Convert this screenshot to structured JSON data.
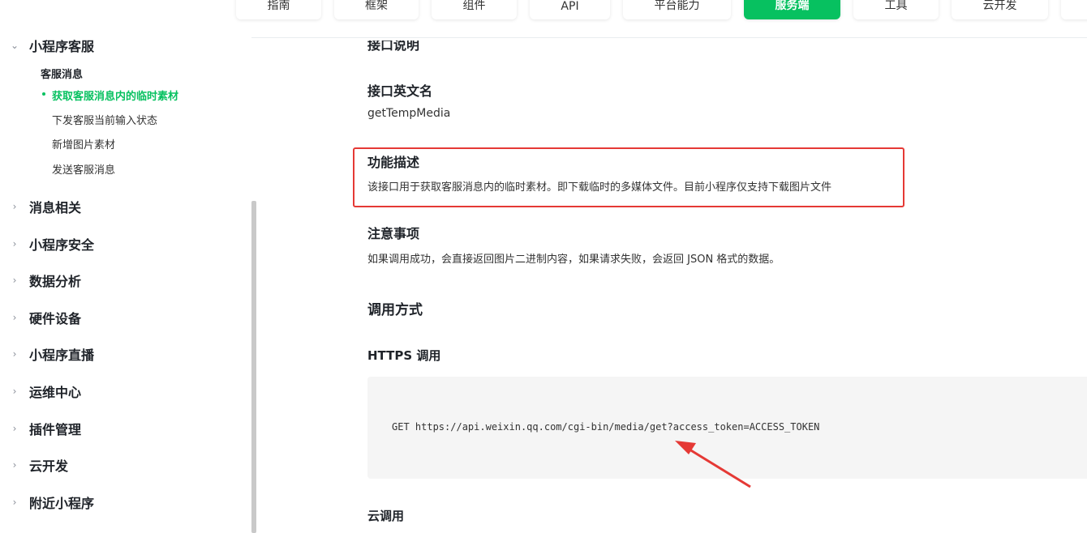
{
  "topnav": {
    "items": [
      {
        "label": "指南"
      },
      {
        "label": "框架"
      },
      {
        "label": "组件"
      },
      {
        "label": "API"
      },
      {
        "label": "平台能力"
      },
      {
        "label": "服务端"
      },
      {
        "label": "工具"
      },
      {
        "label": "云开发"
      }
    ],
    "active": "服务端",
    "accent": "#07c160"
  },
  "sidebar": {
    "section": {
      "label": "小程序客服",
      "icon": "chevron-down-icon"
    },
    "subsection": {
      "label": "客服消息"
    },
    "leaves": [
      {
        "label": "获取客服消息内的临时素材",
        "active": true
      },
      {
        "label": "下发客服当前输入状态"
      },
      {
        "label": "新增图片素材"
      },
      {
        "label": "发送客服消息"
      }
    ],
    "groups": [
      {
        "label": "消息相关"
      },
      {
        "label": "小程序安全"
      },
      {
        "label": "数据分析"
      },
      {
        "label": "硬件设备"
      },
      {
        "label": "小程序直播"
      },
      {
        "label": "运维中心"
      },
      {
        "label": "插件管理"
      },
      {
        "label": "云开发"
      },
      {
        "label": "附近小程序"
      }
    ]
  },
  "content": {
    "interface_desc_title": "接口说明",
    "api_name_title": "接口英文名",
    "api_name": "getTempMedia",
    "func_title": "功能描述",
    "func_text": "该接口用于获取客服消息内的临时素材。即下载临时的多媒体文件。目前小程序仅支持下载图片文件",
    "notice_title": "注意事项",
    "notice_text": "如果调用成功，会直接返回图片二进制内容，如果请求失败，会返回 JSON 格式的数据。",
    "call_title": "调用方式",
    "https_title": "HTTPS 调用",
    "code": "GET https://api.weixin.qq.com/cgi-bin/media/get?access_token=ACCESS_TOKEN",
    "cloud_title": "云调用"
  },
  "annotation": {
    "highlight_color": "#e53935"
  }
}
